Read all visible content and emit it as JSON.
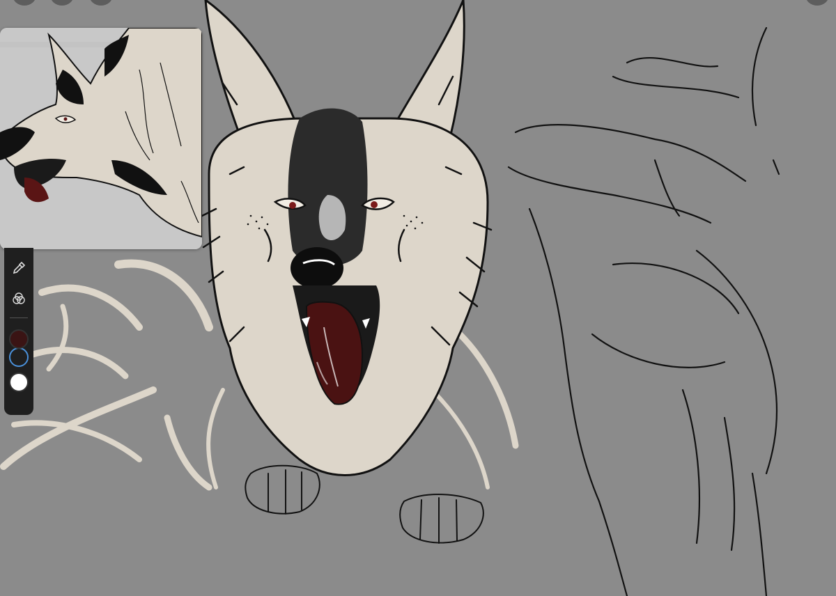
{
  "app": {
    "background_color": "#8b8b8b"
  },
  "top_bar": {
    "buttons": [
      "menu-icon",
      "actions-icon",
      "adjust-icon"
    ],
    "right_button": "layers-icon"
  },
  "reference_window": {
    "background_color": "#c9c9c9",
    "subject": "wolf-head-profile-reference"
  },
  "toolbar": {
    "tools": [
      {
        "name": "eyedropper-icon"
      },
      {
        "name": "color-mixer-icon"
      }
    ],
    "primary_color": "#3a1414",
    "secondary_color": "#1f1f1f",
    "tertiary_color": "#ffffff"
  },
  "artwork": {
    "fur_color": "#ddd6ca",
    "mask_color": "#2a2a2a",
    "tongue_color": "#4a1212",
    "line_color": "#111111"
  }
}
